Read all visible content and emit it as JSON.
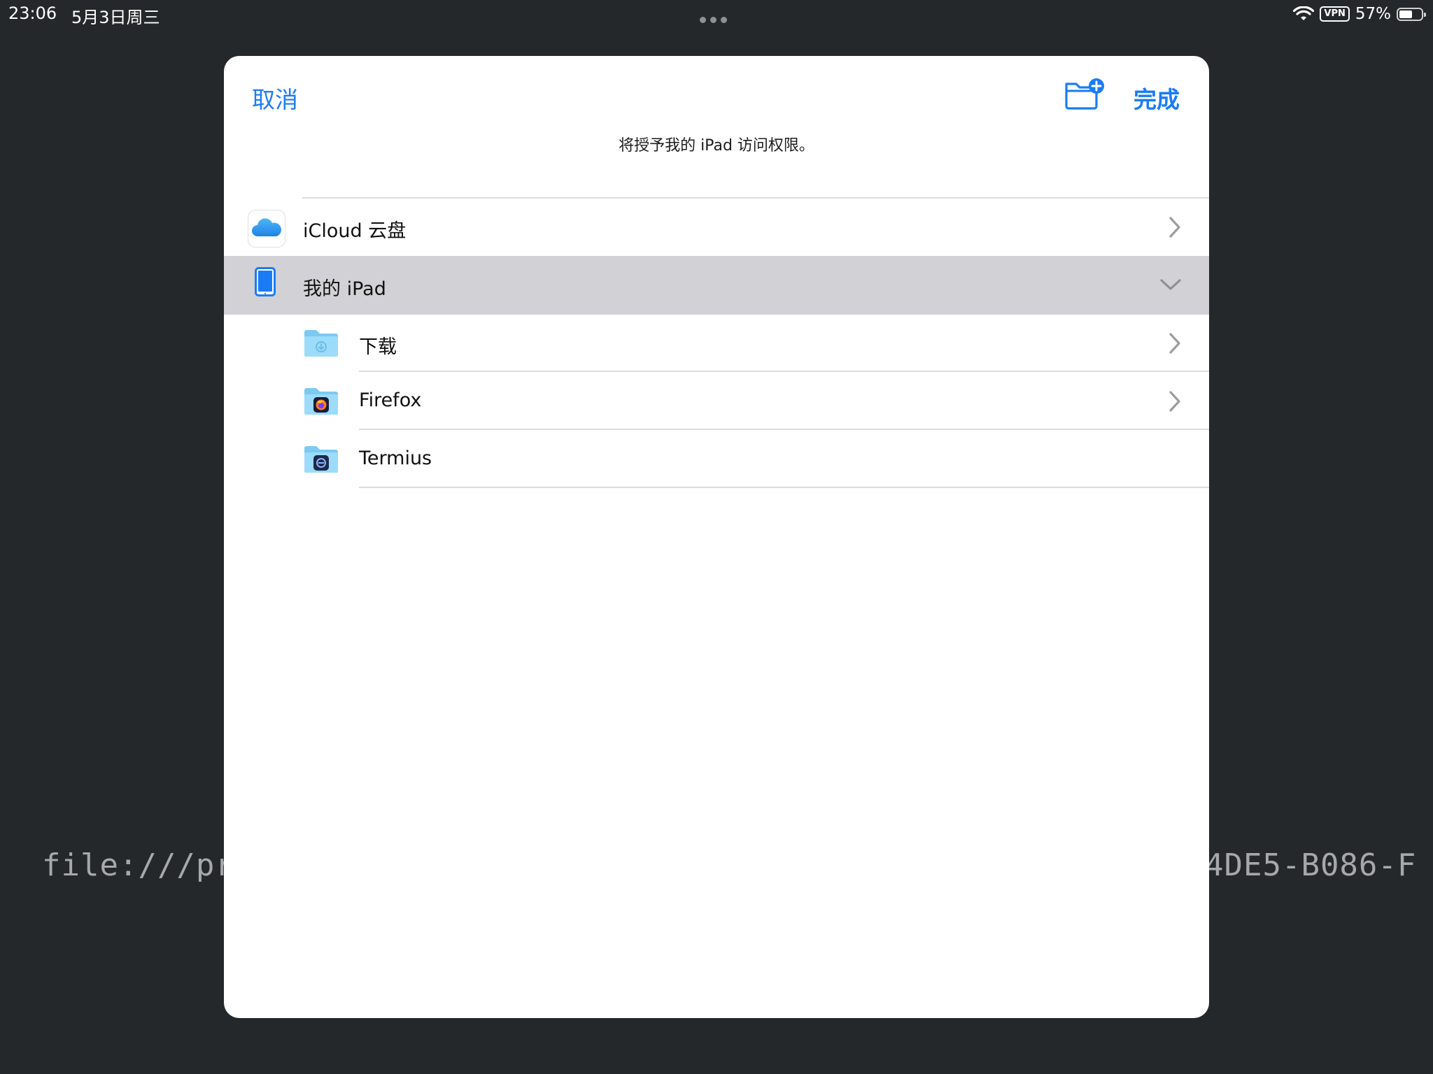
{
  "status_bar": {
    "time": "23:06",
    "date": "5月3日周三",
    "vpn": "VPN",
    "battery": "57%",
    "battery_level": 0.57
  },
  "background": {
    "url_left": "file:///pri",
    "url_right": "4DE5-B086-F"
  },
  "dialog": {
    "cancel_label": "取消",
    "done_label": "完成",
    "subtitle": "将授予我的 iPad 访问权限。",
    "new_folder_icon": "folder-plus-icon",
    "accent_color": "#1a7cf5",
    "locations": [
      {
        "label": "iCloud 云盘",
        "icon": "icloud-icon",
        "expanded": false
      },
      {
        "label": "我的 iPad",
        "icon": "ipad-icon",
        "expanded": true,
        "selected": true
      }
    ],
    "folders": [
      {
        "label": "下载",
        "icon": "download-folder-icon",
        "has_chevron": true
      },
      {
        "label": "Firefox",
        "icon": "firefox-folder-icon",
        "has_chevron": true
      },
      {
        "label": "Termius",
        "icon": "termius-folder-icon",
        "has_chevron": false
      }
    ]
  }
}
